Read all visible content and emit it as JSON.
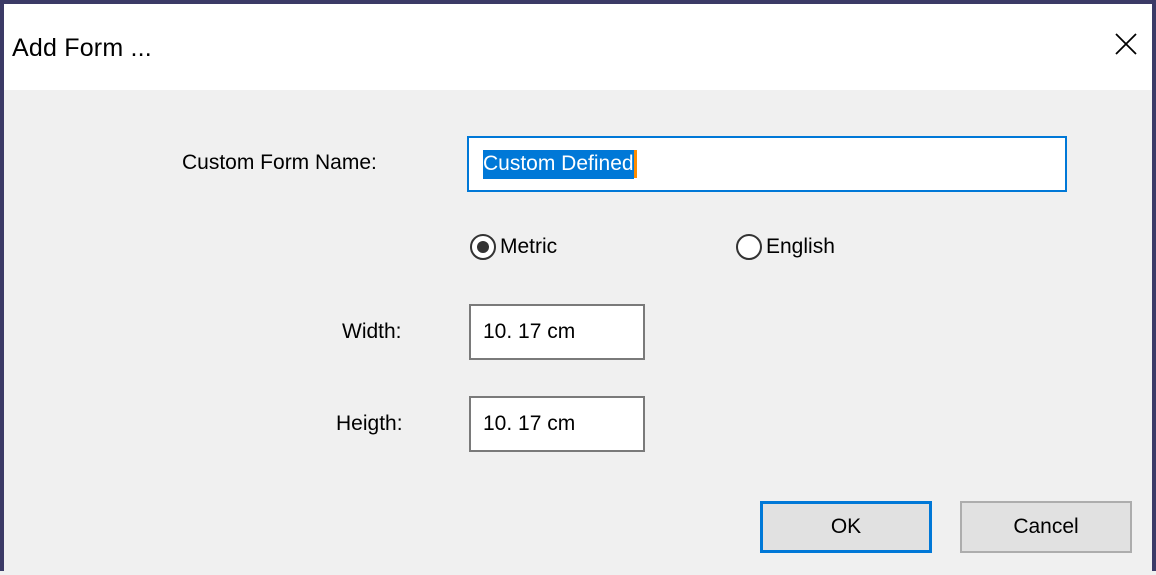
{
  "window": {
    "title": "Add Form ..."
  },
  "form": {
    "name_label": "Custom Form Name:",
    "name_value": "Custom Defined",
    "units": {
      "metric_label": "Metric",
      "english_label": "English",
      "selected": "metric"
    },
    "width_label": "Width:",
    "width_value": "10. 17 cm",
    "height_label": "Heigth:",
    "height_value": "10. 17 cm"
  },
  "buttons": {
    "ok_label": "OK",
    "cancel_label": "Cancel"
  },
  "colors": {
    "accent": "#0078d7",
    "window_border": "#3b3a66",
    "dialog_bg": "#f0f0f0"
  },
  "icons": {
    "close": "close-icon"
  }
}
